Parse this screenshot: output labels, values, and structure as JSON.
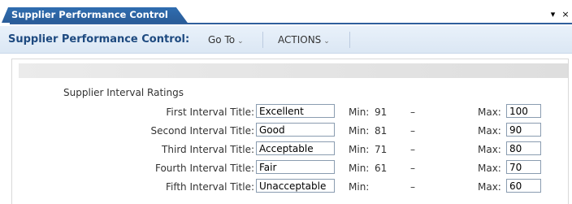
{
  "tab": {
    "title": "Supplier Performance Control"
  },
  "window_controls": {
    "dropdown": "▾",
    "close": "×"
  },
  "menubar": {
    "title": "Supplier Performance Control:",
    "goto_label": "Go To",
    "actions_label": "ACTIONS"
  },
  "section": {
    "label": "Supplier Interval Ratings"
  },
  "rows": [
    {
      "label": "First Interval Title:",
      "title": "Excellent",
      "min_label": "Min:",
      "min": "91",
      "dash": "–",
      "max_label": "Max:",
      "max": "100"
    },
    {
      "label": "Second Interval Title:",
      "title": "Good",
      "min_label": "Min:",
      "min": "81",
      "dash": "–",
      "max_label": "Max:",
      "max": "90"
    },
    {
      "label": "Third Interval Title:",
      "title": "Acceptable",
      "min_label": "Min:",
      "min": "71",
      "dash": "–",
      "max_label": "Max:",
      "max": "80"
    },
    {
      "label": "Fourth Interval Title:",
      "title": "Fair",
      "min_label": "Min:",
      "min": "61",
      "dash": "–",
      "max_label": "Max:",
      "max": "70"
    },
    {
      "label": "Fifth Interval Title:",
      "title": "Unacceptable",
      "min_label": "Min:",
      "min": "",
      "dash": "–",
      "max_label": "Max:",
      "max": "60"
    }
  ]
}
